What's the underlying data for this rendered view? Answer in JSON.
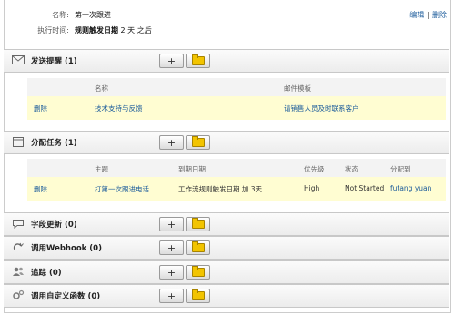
{
  "header": {
    "name_label": "名称:",
    "name_value": "第一次跟进",
    "time_label": "执行时间:",
    "time_value_bold": "规则触发日期",
    "time_value_rest": "2 天 之后",
    "edit_link": "编辑",
    "separator": "|",
    "delete_link": "删除"
  },
  "sections": {
    "email": {
      "title": "发送提醒 (1)",
      "columns": [
        "名称",
        "邮件模板"
      ],
      "rows": [
        {
          "action": "删除",
          "name": "技术支持与反馈",
          "template": "请销售人员及时联系客户"
        }
      ]
    },
    "task": {
      "title": "分配任务 (1)",
      "columns": [
        "主题",
        "到期日期",
        "优先级",
        "状态",
        "分配到"
      ],
      "rows": [
        {
          "action": "删除",
          "subject": "打第一次跟进电话",
          "due": "工作流规则触发日期 加 3天",
          "priority": "High",
          "status": "Not Started",
          "assignee": "futang yuan"
        }
      ]
    },
    "field": {
      "title": "字段更新 (0)"
    },
    "webhook": {
      "title": "调用Webhook (0)"
    },
    "track": {
      "title": "追踪 (0)"
    },
    "custom": {
      "title": "调用自定义函数 (0)"
    }
  },
  "buttons": {
    "add": "+"
  }
}
